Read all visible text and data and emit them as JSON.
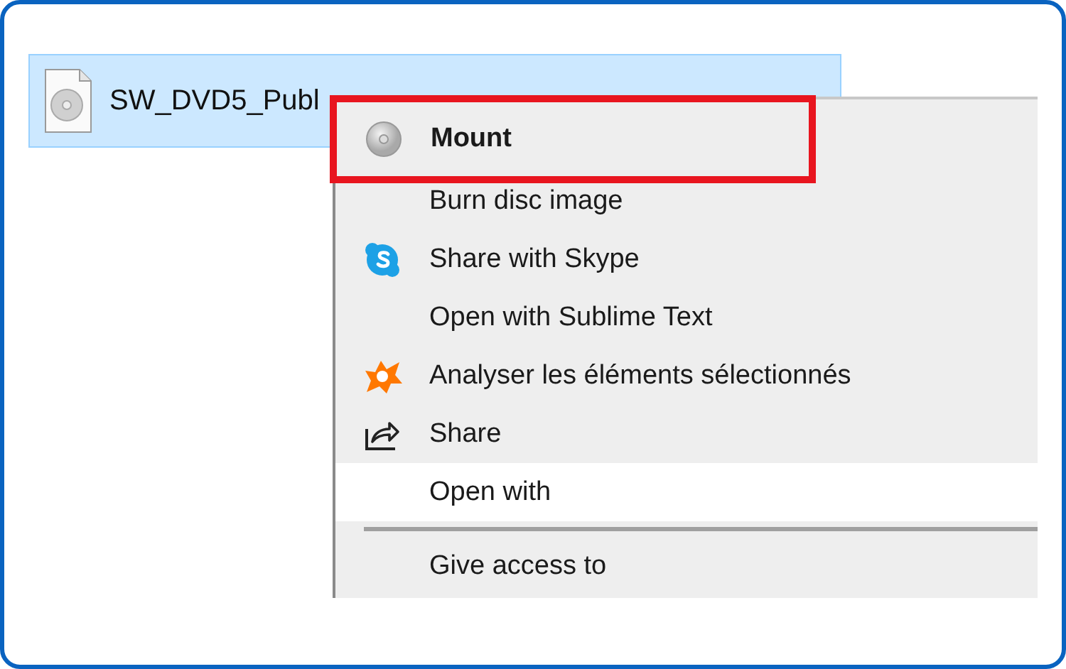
{
  "file": {
    "name": "SW_DVD5_Publ",
    "selected": true
  },
  "context_menu": {
    "items": [
      {
        "kind": "item",
        "label": "Mount",
        "default": true,
        "hovered": false,
        "annotated": true
      },
      {
        "kind": "item",
        "label": "Burn disc image",
        "default": false,
        "hovered": false,
        "annotated": false
      },
      {
        "kind": "item",
        "label": "Share with Skype",
        "default": false,
        "hovered": false,
        "annotated": false
      },
      {
        "kind": "item",
        "label": "Open with Sublime Text",
        "default": false,
        "hovered": false,
        "annotated": false
      },
      {
        "kind": "item",
        "label": "Analyser les éléments sélectionnés",
        "default": false,
        "hovered": false,
        "annotated": false
      },
      {
        "kind": "item",
        "label": "Share",
        "default": false,
        "hovered": false,
        "annotated": false
      },
      {
        "kind": "item",
        "label": "Open with",
        "default": false,
        "hovered": true,
        "annotated": false
      },
      {
        "kind": "separator"
      },
      {
        "kind": "item",
        "label": "Give access to",
        "default": false,
        "hovered": false,
        "annotated": false
      }
    ]
  }
}
